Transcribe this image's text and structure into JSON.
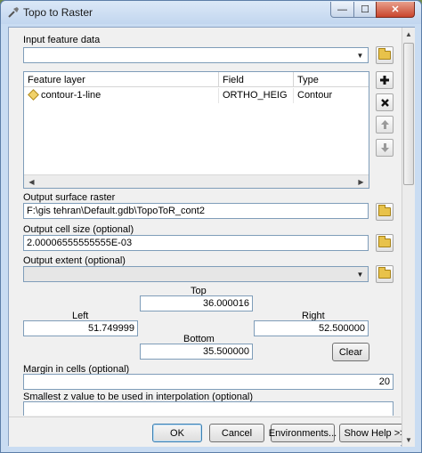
{
  "window": {
    "title": "Topo to Raster"
  },
  "input_feature_data": {
    "label": "Input feature data",
    "value": ""
  },
  "feature_table": {
    "columns": [
      "Feature layer",
      "Field",
      "Type"
    ],
    "rows": [
      {
        "layer": "contour-1-line",
        "field": "ORTHO_HEIG",
        "type": "Contour"
      }
    ]
  },
  "output_surface_raster": {
    "label": "Output surface raster",
    "value": "F:\\gis tehran\\Default.gdb\\TopoToR_cont2"
  },
  "output_cell_size": {
    "label": "Output cell size (optional)",
    "value": "2.00006555555555E-03"
  },
  "output_extent": {
    "label": "Output extent (optional)",
    "value": "",
    "top_label": "Top",
    "top": "36.000016",
    "left_label": "Left",
    "left": "51.749999",
    "right_label": "Right",
    "right": "52.500000",
    "bottom_label": "Bottom",
    "bottom": "35.500000",
    "clear_label": "Clear"
  },
  "margin_in_cells": {
    "label": "Margin in cells (optional)",
    "value": "20"
  },
  "smallest_z": {
    "label": "Smallest z value to be used in interpolation (optional)",
    "value": ""
  },
  "buttons": {
    "ok": "OK",
    "cancel": "Cancel",
    "environments": "Environments...",
    "show_help": "Show Help >>"
  },
  "window_controls": {
    "minimize": "—",
    "maximize": "☐",
    "close": "✕"
  },
  "icons": [
    "tool-icon",
    "folder-icon",
    "plus-icon",
    "delete-icon",
    "arrow-up-icon",
    "arrow-down-icon",
    "layer-icon"
  ]
}
